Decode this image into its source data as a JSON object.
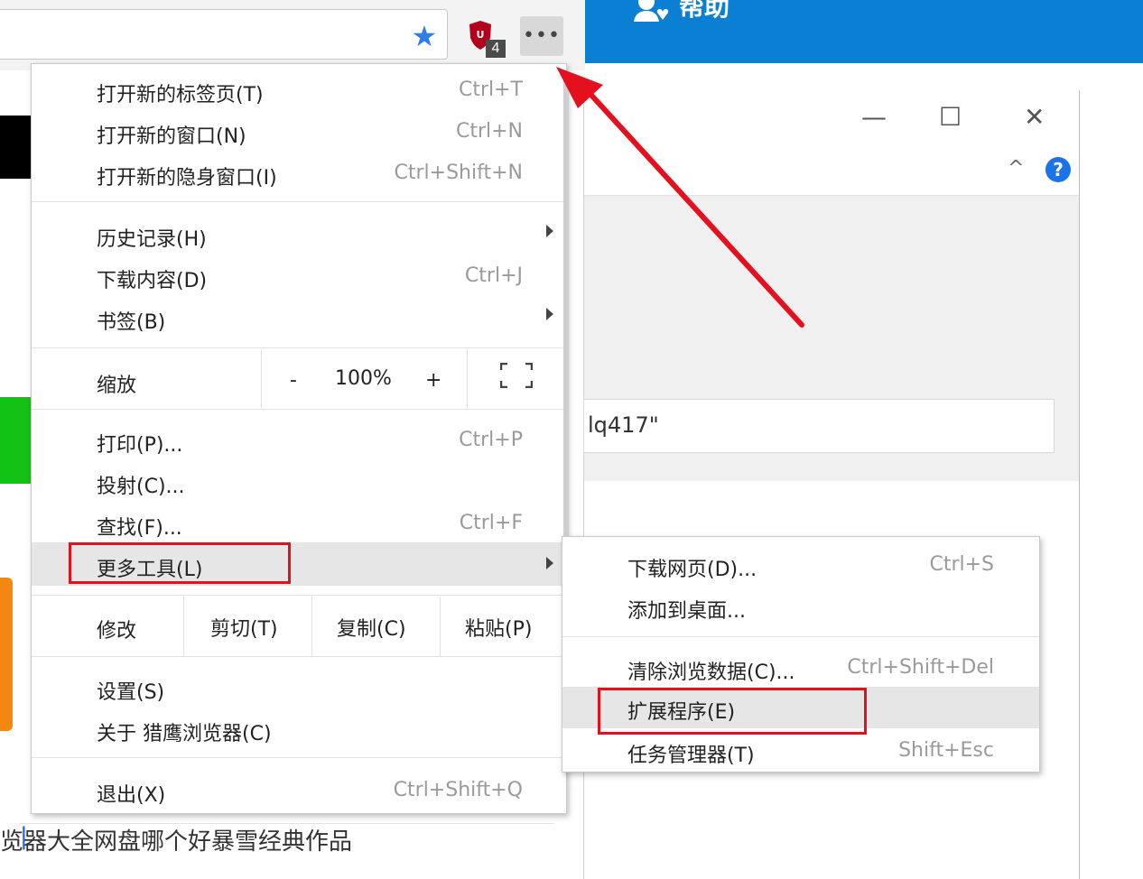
{
  "toolbar": {
    "ublock_badge": "4",
    "more_icon": "more-horizontal-icon",
    "more_glyph": "•••"
  },
  "header": {
    "title": "帮助"
  },
  "menu": {
    "items": [
      {
        "label": "打开新的标签页(T)",
        "shortcut": "Ctrl+T"
      },
      {
        "label": "打开新的窗口(N)",
        "shortcut": "Ctrl+N"
      },
      {
        "label": "打开新的隐身窗口(I)",
        "shortcut": "Ctrl+Shift+N"
      },
      {
        "label": "历史记录(H)",
        "shortcut": ""
      },
      {
        "label": "下载内容(D)",
        "shortcut": "Ctrl+J"
      },
      {
        "label": "书签(B)",
        "shortcut": ""
      },
      {
        "label": "打印(P)...",
        "shortcut": "Ctrl+P"
      },
      {
        "label": "投射(C)...",
        "shortcut": ""
      },
      {
        "label": "查找(F)...",
        "shortcut": "Ctrl+F"
      },
      {
        "label": "更多工具(L)",
        "shortcut": ""
      },
      {
        "label": "设置(S)",
        "shortcut": ""
      },
      {
        "label": "关于 猎鹰浏览器(C)",
        "shortcut": ""
      },
      {
        "label": "退出(X)",
        "shortcut": "Ctrl+Shift+Q"
      }
    ],
    "zoom": {
      "label": "缩放",
      "minus": "-",
      "value": "100%",
      "plus": "+"
    },
    "edit": {
      "label": "修改",
      "cut": "剪切(T)",
      "copy": "复制(C)",
      "paste": "粘贴(P)"
    }
  },
  "submenu": {
    "items": [
      {
        "label": "下载网页(D)...",
        "shortcut": "Ctrl+S"
      },
      {
        "label": "添加到桌面...",
        "shortcut": ""
      },
      {
        "label": "清除浏览数据(C)...",
        "shortcut": "Ctrl+Shift+Del"
      },
      {
        "label": "扩展程序(E)",
        "shortcut": ""
      },
      {
        "label": "任务管理器(T)",
        "shortcut": "Shift+Esc"
      }
    ]
  },
  "dialog": {
    "input_value": "lq417\"",
    "minimize": "—",
    "maximize": "☐",
    "close": "✕",
    "help": "?",
    "collapse": "^"
  },
  "footer": {
    "links": [
      "览器大全",
      "网盘哪个好",
      "暴雪经典作品"
    ],
    "separator": "|"
  },
  "colors": {
    "highlight_box": "#e5101d",
    "header_blue": "#0a7fd4",
    "star_blue": "#2d7ee6"
  }
}
